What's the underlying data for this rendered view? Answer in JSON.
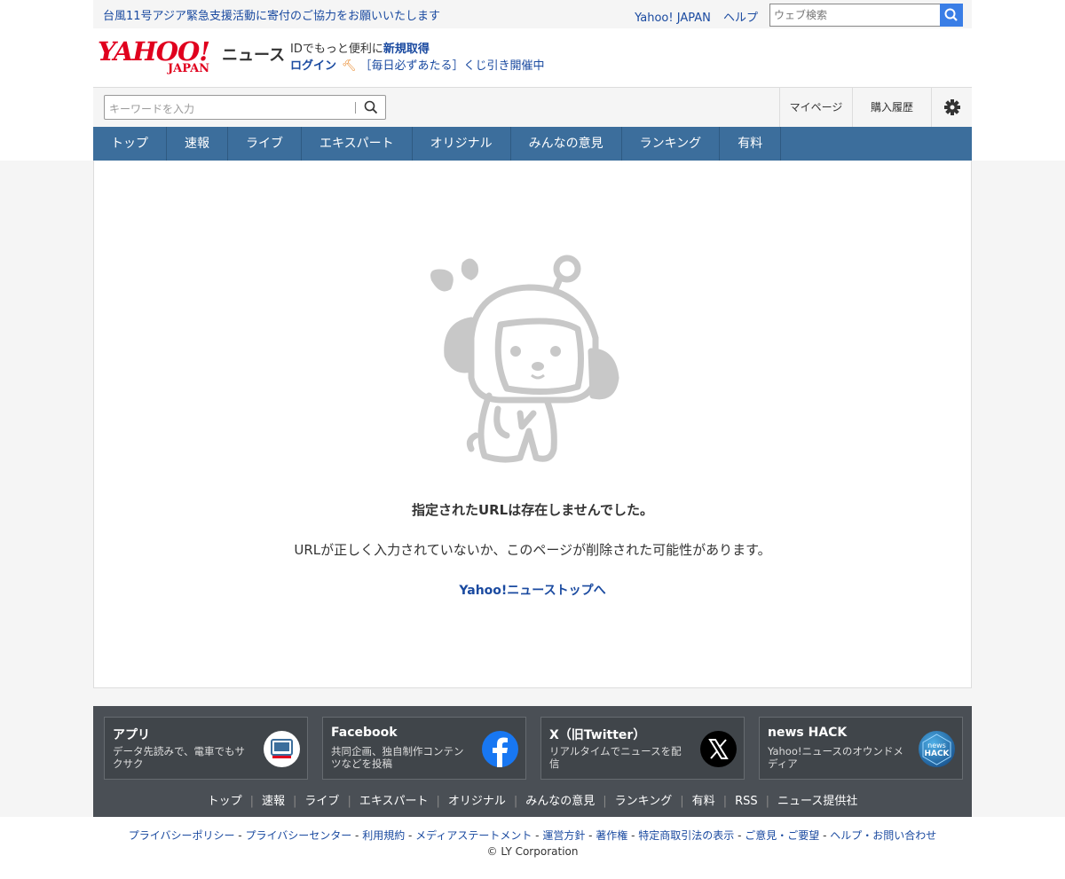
{
  "topbar": {
    "notice": "台風11号アジア緊急支援活動に寄付のご協力をお願いいたします",
    "yahoo_japan": "Yahoo! JAPAN",
    "help": "ヘルプ",
    "search_placeholder": "ウェブ検索"
  },
  "header": {
    "logo_main": "YAHOO!",
    "logo_sub": "JAPAN",
    "logo_news": "ニュース",
    "id_text": "IDでもっと便利に",
    "signup": "新規取得",
    "login": "ログイン",
    "lottery": "［毎日必ずあたる］くじ引き開催中"
  },
  "searchbar": {
    "placeholder": "キーワードを入力",
    "mypage": "マイページ",
    "history": "購入履歴"
  },
  "nav": [
    "トップ",
    "速報",
    "ライブ",
    "エキスパート",
    "オリジナル",
    "みんなの意見",
    "ランキング",
    "有料"
  ],
  "error": {
    "title": "指定されたURLは存在しませんでした。",
    "message": "URLが正しく入力されていないか、このページが削除された可能性があります。",
    "back_link": "Yahoo!ニューストップへ"
  },
  "footer": {
    "cards": [
      {
        "title": "アプリ",
        "desc": "データ先読みで、電車でもサクサク"
      },
      {
        "title": "Facebook",
        "desc": "共同企画、独自制作コンテンツなどを投稿"
      },
      {
        "title": "X（旧Twitter）",
        "desc": "リアルタイムでニュースを配信"
      },
      {
        "title": "news HACK",
        "desc": "Yahoo!ニュースのオウンドメディア"
      }
    ],
    "nav": [
      "トップ",
      "速報",
      "ライブ",
      "エキスパート",
      "オリジナル",
      "みんなの意見",
      "ランキング",
      "有料",
      "RSS",
      "ニュース提供社"
    ],
    "policy": [
      "プライバシーポリシー",
      "プライバシーセンター",
      "利用規約",
      "メディアステートメント",
      "運営方針",
      "著作権",
      "特定商取引法の表示",
      "ご意見・ご要望",
      "ヘルプ・お問い合わせ"
    ],
    "copyright": "© LY Corporation"
  },
  "colors": {
    "nav_bg": "#3c6e9c",
    "footer_bg": "#4a4f55",
    "link": "#1a4aa0",
    "brand_red": "#e0001e"
  }
}
